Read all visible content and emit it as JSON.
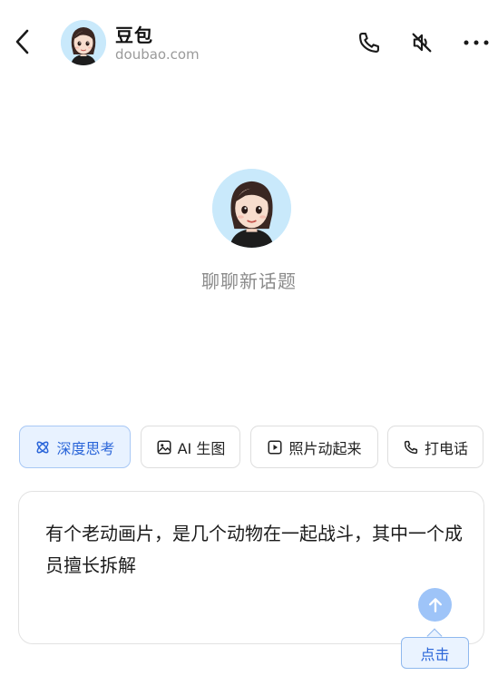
{
  "header": {
    "name": "豆包",
    "subtitle": "doubao.com",
    "back_icon": "chevron-left-icon",
    "call_icon": "phone-icon",
    "mute_icon": "speaker-muted-icon",
    "more_icon": "more-dots-icon"
  },
  "main": {
    "title": "聊聊新话题"
  },
  "chips": [
    {
      "label": "深度思考",
      "icon": "atom-icon",
      "active": true
    },
    {
      "label": "AI 生图",
      "icon": "image-icon",
      "active": false
    },
    {
      "label": "照片动起来",
      "icon": "play-icon",
      "active": false
    },
    {
      "label": "打电话",
      "icon": "phone-icon",
      "active": false
    }
  ],
  "input": {
    "value": "有个老动画片，是几个动物在一起战斗，其中一个成员擅长拆解",
    "send_icon": "arrow-up-icon"
  },
  "tooltip": {
    "label": "点击"
  },
  "colors": {
    "accent": "#2b66d9",
    "send_button": "#9ec4f8",
    "chip_active_bg": "#e8f2ff"
  }
}
